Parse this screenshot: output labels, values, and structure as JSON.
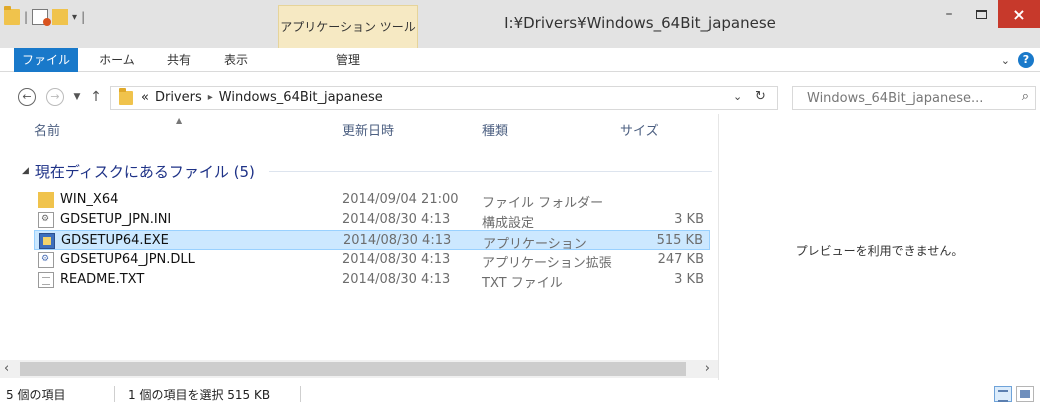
{
  "window": {
    "title": "I:¥Drivers¥Windows_64Bit_japanese",
    "context_tab_header": "アプリケーション ツール",
    "buttons": {
      "minimize": "–",
      "close": "×"
    }
  },
  "ribbon": {
    "tabs": {
      "file": "ファイル",
      "home": "ホーム",
      "share": "共有",
      "view": "表示",
      "manage": "管理"
    },
    "help": "?"
  },
  "address": {
    "overflow": "«",
    "crumbs": [
      "Drivers",
      "Windows_64Bit_japanese"
    ],
    "search_placeholder": "Windows_64Bit_japanese..."
  },
  "columns": {
    "name": "名前",
    "date": "更新日時",
    "type": "種類",
    "size": "サイズ"
  },
  "group": {
    "label": "現在ディスクにあるファイル (5)"
  },
  "files": [
    {
      "name": "WIN_X64",
      "date": "2014/09/04 21:00",
      "type": "ファイル フォルダー",
      "size": "",
      "icon": "folder-icon"
    },
    {
      "name": "GDSETUP_JPN.INI",
      "date": "2014/08/30 4:13",
      "type": "構成設定",
      "size": "3 KB",
      "icon": "ini-file-icon"
    },
    {
      "name": "GDSETUP64.EXE",
      "date": "2014/08/30 4:13",
      "type": "アプリケーション",
      "size": "515 KB",
      "icon": "exe-file-icon",
      "selected": true
    },
    {
      "name": "GDSETUP64_JPN.DLL",
      "date": "2014/08/30 4:13",
      "type": "アプリケーション拡張",
      "size": "247 KB",
      "icon": "dll-file-icon"
    },
    {
      "name": "README.TXT",
      "date": "2014/08/30 4:13",
      "type": "TXT ファイル",
      "size": "3 KB",
      "icon": "txt-file-icon"
    }
  ],
  "preview": {
    "message": "プレビューを利用できません。"
  },
  "status": {
    "item_count": "5 個の項目",
    "selection": "1 個の項目を選択 515 KB"
  },
  "colors": {
    "accent": "#1979ca",
    "selection_bg": "#cce8ff",
    "close_btn": "#c7392b",
    "group_text": "#1e3287"
  }
}
